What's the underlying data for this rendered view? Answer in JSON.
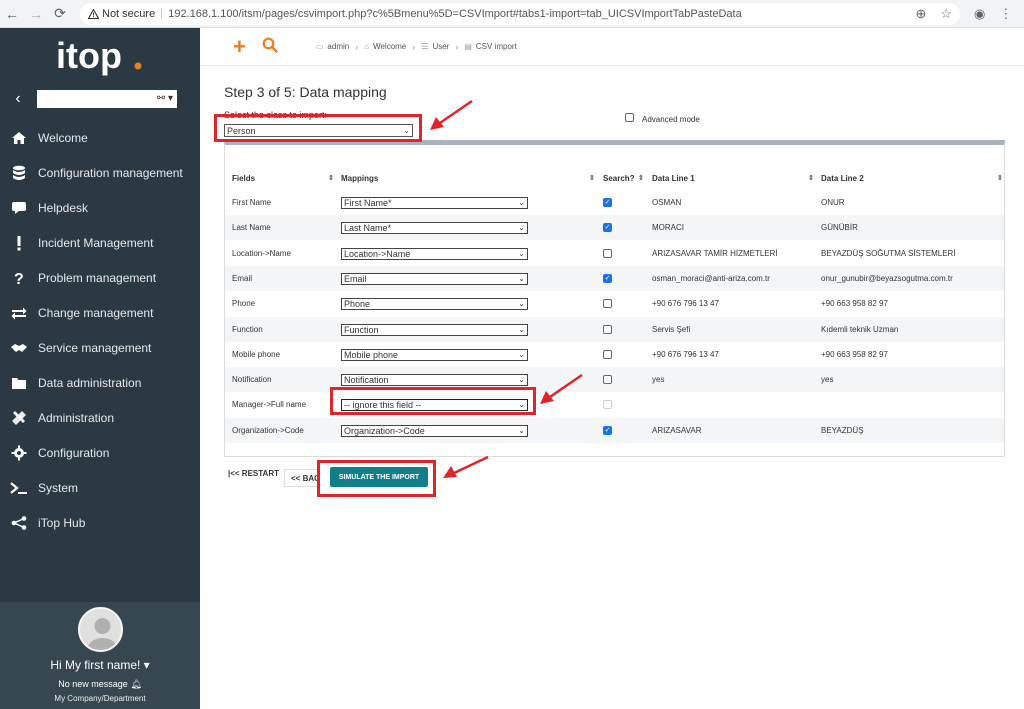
{
  "browser": {
    "not_secure": "Not secure",
    "url": "192.168.1.100/itsm/pages/csvimport.php?c%5Bmenu%5D=CSVImport#tabs1-import=tab_UICSVImportTabPasteData"
  },
  "logo": {
    "text": "itop",
    "dot_color": "#ea7d1e"
  },
  "sidebar": {
    "items": [
      {
        "label": "Welcome",
        "icon": "home-icon"
      },
      {
        "label": "Configuration management",
        "icon": "database-icon"
      },
      {
        "label": "Helpdesk",
        "icon": "comment-icon"
      },
      {
        "label": "Incident Management",
        "icon": "exclamation-icon"
      },
      {
        "label": "Problem management",
        "icon": "question-icon"
      },
      {
        "label": "Change management",
        "icon": "exchange-icon"
      },
      {
        "label": "Service management",
        "icon": "handshake-icon"
      },
      {
        "label": "Data administration",
        "icon": "folder-icon"
      },
      {
        "label": "Administration",
        "icon": "tools-icon"
      },
      {
        "label": "Configuration",
        "icon": "cog-icon"
      },
      {
        "label": "System",
        "icon": "terminal-icon"
      },
      {
        "label": "iTop Hub",
        "icon": "share-icon"
      }
    ],
    "user": {
      "greeting": "Hi My first name!",
      "messages": "No new message",
      "org": "My Company/Department"
    }
  },
  "breadcrumb": [
    "admin",
    "Welcome",
    "User",
    "CSV import"
  ],
  "main": {
    "title": "Step 3 of 5: Data mapping",
    "class_label": "Select the class to import:",
    "class_value": "Person",
    "advanced_mode": "Advanced mode",
    "columns": [
      "Fields",
      "Mappings",
      "Search?",
      "Data Line 1",
      "Data Line 2"
    ],
    "rows": [
      {
        "field": "First Name",
        "mapping": "First Name*",
        "search": true,
        "line1": "OSMAN",
        "line2": "ONUR"
      },
      {
        "field": "Last Name",
        "mapping": "Last Name*",
        "search": true,
        "line1": "MORACI",
        "line2": "GÜNÜBİR"
      },
      {
        "field": "Location->Name",
        "mapping": "Location->Name",
        "search": false,
        "line1": "ARIZASAVAR TAMİR HİZMETLERİ",
        "line2": "BEYAZDÜŞ SOĞUTMA SİSTEMLERİ"
      },
      {
        "field": "Email",
        "mapping": "Email",
        "search": true,
        "line1": "osman_moraci@anti-ariza.com.tr",
        "line2": "onur_gunubir@beyazsogutma.com.tr"
      },
      {
        "field": "Phone",
        "mapping": "Phone",
        "search": false,
        "line1": "+90 676 796 13 47",
        "line2": "+90 663 958 82 97"
      },
      {
        "field": "Function",
        "mapping": "Function",
        "search": false,
        "line1": "Servis Şefi",
        "line2": "Kıdemli teknik Uzman"
      },
      {
        "field": "Mobile phone",
        "mapping": "Mobile phone",
        "search": false,
        "line1": "+90 676 796 13 47",
        "line2": "+90 663 958 82 97"
      },
      {
        "field": "Notification",
        "mapping": "Notification",
        "search": false,
        "line1": "yes",
        "line2": "yes"
      },
      {
        "field": "Manager->Full name",
        "mapping": "-- ignore this field --",
        "search": false,
        "line1": "",
        "line2": ""
      },
      {
        "field": "Organization->Code",
        "mapping": "Organization->Code",
        "search": true,
        "line1": "ARIZASAVAR",
        "line2": "BEYAZDÜŞ"
      }
    ],
    "btn_restart": "|<< RESTART",
    "btn_back": "<< BACK",
    "btn_simulate": "SIMULATE THE IMPORT"
  },
  "colors": {
    "sidebar": "#2b3a42",
    "accent": "#ea7d1e",
    "primary_button": "#117f8a",
    "annotation": "#e0252a"
  }
}
